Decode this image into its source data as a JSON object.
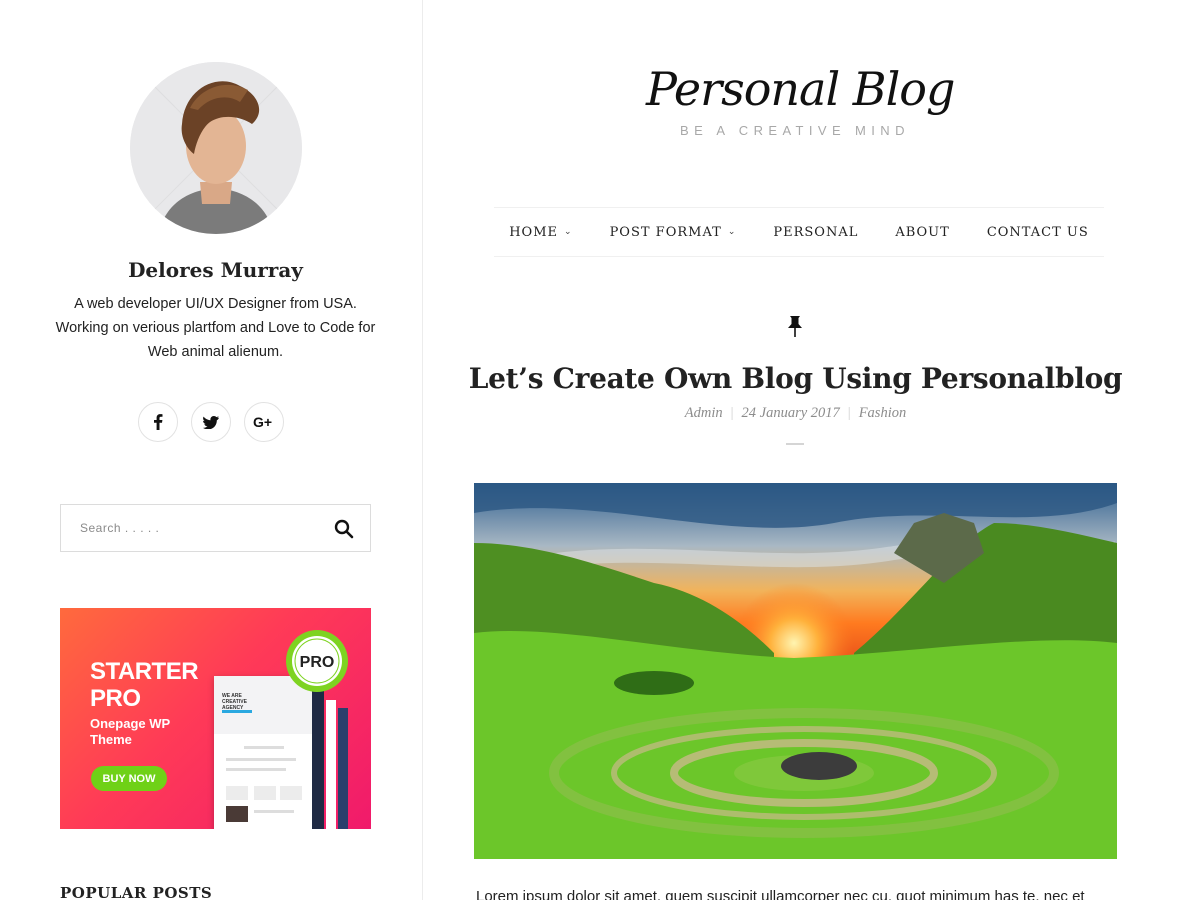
{
  "author": {
    "name": "Delores Murray",
    "bio": "A web developer UI/UX Designer from USA. Working on verious plartfom and Love to Code for Web animal alienum."
  },
  "social": [
    {
      "icon": "facebook-icon",
      "glyph": "f"
    },
    {
      "icon": "twitter-icon",
      "glyph": "t"
    },
    {
      "icon": "google-plus-icon",
      "glyph": "G+"
    }
  ],
  "search": {
    "placeholder": "Search . . . . ."
  },
  "promo": {
    "title": "STARTER PRO",
    "subtitle": "Onepage WP Theme",
    "button": "BUY NOW",
    "badge": "PRO",
    "mock_heading": "WE ARE CREATIVE AGENCY",
    "colors": {
      "gradient_start": "#ff6a3d",
      "gradient_end": "#f01a6b",
      "button": "#6fd117"
    }
  },
  "sidebar_section": {
    "popular_title": "POPULAR POSTS"
  },
  "site": {
    "logo": "Personal Blog",
    "tagline": "BE A CREATIVE MIND"
  },
  "nav": {
    "items": [
      {
        "label": "HOME",
        "dropdown": true
      },
      {
        "label": "POST FORMAT",
        "dropdown": true
      },
      {
        "label": "PERSONAL",
        "dropdown": false
      },
      {
        "label": "ABOUT",
        "dropdown": false
      },
      {
        "label": "CONTACT US",
        "dropdown": false
      }
    ]
  },
  "post": {
    "title": "Let’s Create Own Blog Using Personalblog",
    "author": "Admin",
    "date": "24 January 2017",
    "category": "Fashion",
    "excerpt": "Lorem ipsum dolor sit amet, quem suscipit ullamcorper nec cu, quot minimum has te, nec et"
  }
}
